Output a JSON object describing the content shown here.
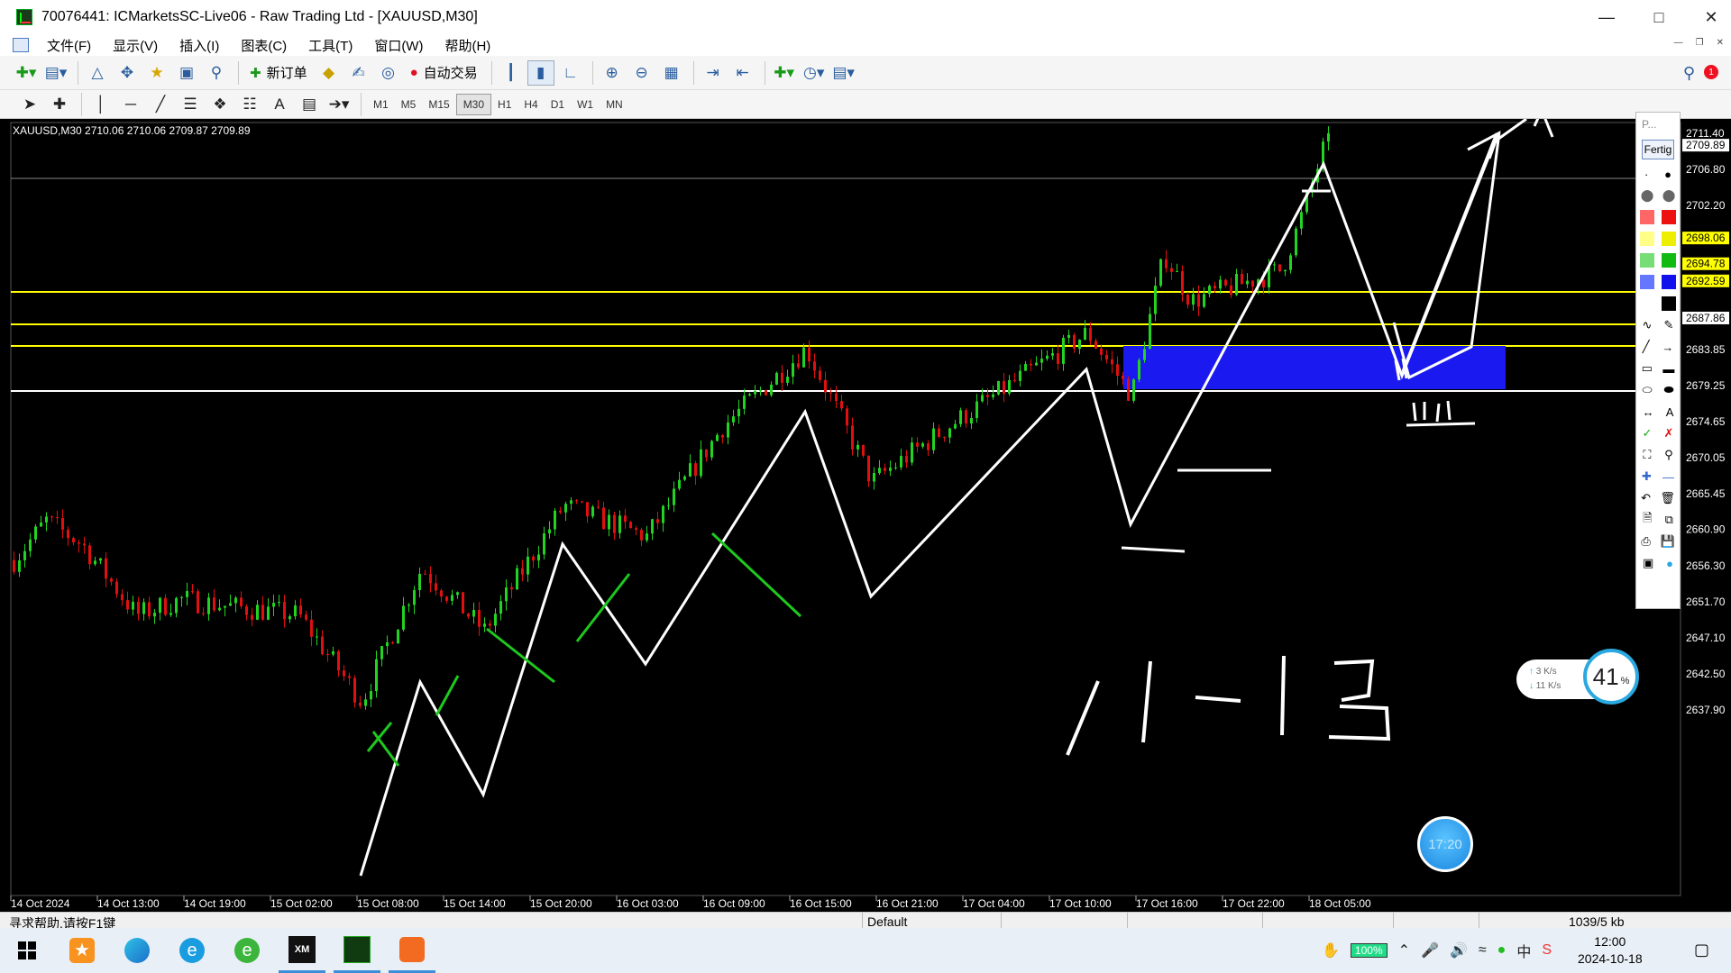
{
  "window": {
    "title": "70076441: ICMarketsSC-Live06 - Raw Trading Ltd - [XAUUSD,M30]"
  },
  "menu": [
    {
      "label": "文件(F)"
    },
    {
      "label": "显示(V)"
    },
    {
      "label": "插入(I)"
    },
    {
      "label": "图表(C)"
    },
    {
      "label": "工具(T)"
    },
    {
      "label": "窗口(W)"
    },
    {
      "label": "帮助(H)"
    }
  ],
  "toolbar": {
    "new_order": "新订单",
    "auto_trading": "自动交易"
  },
  "timeframes": [
    "M1",
    "M5",
    "M15",
    "M30",
    "H1",
    "H4",
    "D1",
    "W1",
    "MN"
  ],
  "active_timeframe": "M30",
  "chart": {
    "symbol_info": "XAUUSD,M30  2710.06 2710.06 2709.87 2709.89",
    "price_labels": [
      "2711.40",
      "2706.80",
      "2702.20",
      "2683.85",
      "2679.25",
      "2674.65",
      "2670.05",
      "2665.45",
      "2660.90",
      "2656.30",
      "2651.70",
      "2647.10",
      "2642.50",
      "2637.90"
    ],
    "marked_prices": [
      {
        "value": "2709.89",
        "bg": "#ffffff",
        "fg": "#000000"
      },
      {
        "value": "2698.06",
        "bg": "#ffff00",
        "fg": "#000000"
      },
      {
        "value": "2694.78",
        "bg": "#ffff00",
        "fg": "#000000"
      },
      {
        "value": "2692.59",
        "bg": "#ffff00",
        "fg": "#000000"
      },
      {
        "value": "2687.86",
        "bg": "#ffffff",
        "fg": "#000000"
      }
    ],
    "time_labels": [
      "14 Oct 2024",
      "14 Oct 13:00",
      "14 Oct 19:00",
      "15 Oct 02:00",
      "15 Oct 08:00",
      "15 Oct 14:00",
      "15 Oct 20:00",
      "16 Oct 03:00",
      "16 Oct 09:00",
      "16 Oct 15:00",
      "16 Oct 21:00",
      "17 Oct 04:00",
      "17 Oct 10:00",
      "17 Oct 16:00",
      "17 Oct 22:00",
      "18 Oct 05:00"
    ],
    "colors": {
      "bull": "#22d322",
      "bear": "#e01010",
      "level": "#ffff00",
      "zone": "#1a1af0"
    }
  },
  "palette": {
    "title": "P...",
    "done_label": "Fertig"
  },
  "widgets": {
    "net_up": "3  K/s",
    "net_down": "11  K/s",
    "cpu": "41",
    "cpu_unit": "%",
    "bubble_time": "17:20"
  },
  "statusbar": {
    "help": "寻求帮助,请按F1键",
    "profile": "Default",
    "traffic": "1039/5 kb"
  },
  "taskbar": {
    "battery": "100%",
    "time": "12:00",
    "date": "2024-10-18"
  }
}
